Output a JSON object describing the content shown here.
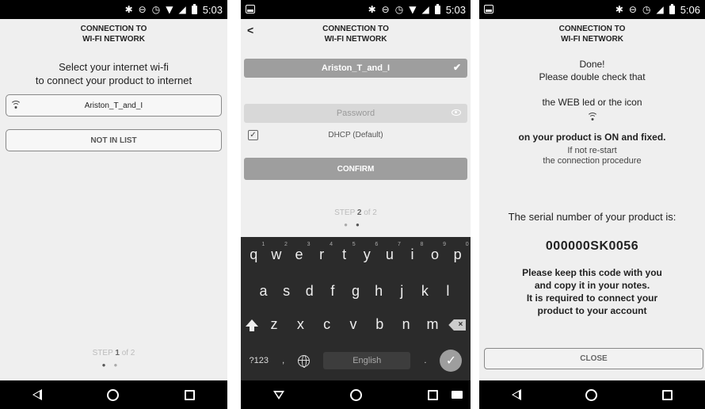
{
  "status_bar": {
    "phone1_time": "5:03",
    "phone2_time": "5:03",
    "phone3_time": "5:06"
  },
  "header": {
    "title_line1": "CONNECTION TO",
    "title_line2": "WI-FI NETWORK"
  },
  "screen1": {
    "instruction_line1": "Select your internet wi-fi",
    "instruction_line2": "to connect your product to internet",
    "network_name": "Ariston_T_and_I",
    "not_in_list_label": "NOT IN LIST",
    "step_prefix": "STEP",
    "step_current": "1",
    "step_suffix": "of 2"
  },
  "screen2": {
    "selected_network": "Ariston_T_and_I",
    "password_placeholder": "Password",
    "dhcp_label": "DHCP (Default)",
    "confirm_label": "CONFIRM",
    "step_prefix": "STEP",
    "step_current": "2",
    "step_suffix": "of 2",
    "keyboard": {
      "row1": [
        "q",
        "w",
        "e",
        "r",
        "t",
        "y",
        "u",
        "i",
        "o",
        "p"
      ],
      "row1_digits": [
        "1",
        "2",
        "3",
        "4",
        "5",
        "6",
        "7",
        "8",
        "9",
        "0"
      ],
      "row2": [
        "a",
        "s",
        "d",
        "f",
        "g",
        "h",
        "j",
        "k",
        "l"
      ],
      "row3": [
        "z",
        "x",
        "c",
        "v",
        "b",
        "n",
        "m"
      ],
      "symbols_key": "?123",
      "comma_key": ",",
      "space_label": "English",
      "period_key": "."
    }
  },
  "screen3": {
    "done_title": "Done!",
    "double_check": "Please double check that",
    "web_led": "the WEB led or the icon",
    "on_product": "on your product is ON and fixed.",
    "restart_line1": "If not re-start",
    "restart_line2": "the connection procedure",
    "serial_label": "The serial number of your product is:",
    "serial_number": "000000SK0056",
    "keep_line1": "Please keep this code with you",
    "keep_line2": "and copy it in your notes.",
    "keep_line3": "It is required to connect your",
    "keep_line4": "product to your account",
    "close_label": "CLOSE"
  },
  "icons": {
    "status": [
      "bluetooth-icon",
      "do-not-disturb-icon",
      "alarm-icon",
      "wifi-signal-icon",
      "cell-signal-icon",
      "battery-icon"
    ],
    "nav": [
      "back-icon",
      "home-icon",
      "recents-icon"
    ]
  }
}
